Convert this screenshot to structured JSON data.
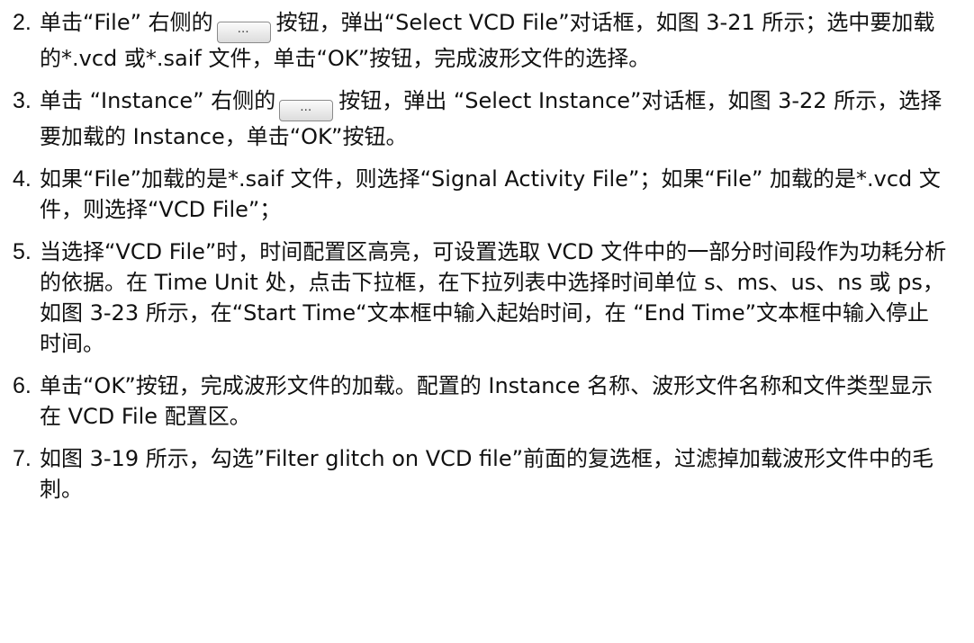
{
  "steps": [
    {
      "num": "2.",
      "parts": [
        {
          "t": "text",
          "v": "单击“File” 右侧的"
        },
        {
          "t": "button",
          "v": "…",
          "name": "ellipsis-button-icon"
        },
        {
          "t": "text",
          "v": "按钮，弹出“Select VCD File”对话框，如图 3-21 所示；选中要加载的*.vcd 或*.saif 文件，单击“OK”按钮，完成波形文件的选择。"
        }
      ]
    },
    {
      "num": "3.",
      "parts": [
        {
          "t": "text",
          "v": "单击 “Instance” 右侧的"
        },
        {
          "t": "button",
          "v": "…",
          "name": "ellipsis-button-icon"
        },
        {
          "t": "text",
          "v": "按钮，弹出 “Select Instance”对话框，如图 3-22 所示，选择要加载的 Instance，单击“OK”按钮。"
        }
      ]
    },
    {
      "num": "4.",
      "parts": [
        {
          "t": "text",
          "v": "如果“File”加载的是*.saif 文件，则选择“Signal Activity File”；如果“File” 加载的是*.vcd 文件，则选择“VCD File”；"
        }
      ]
    },
    {
      "num": "5.",
      "parts": [
        {
          "t": "text",
          "v": "当选择“VCD File”时，时间配置区高亮，可设置选取 VCD 文件中的一部分时间段作为功耗分析的依据。在 Time Unit 处，点击下拉框，在下拉列表中选择时间单位 s、ms、us、ns 或 ps，如图 3-23 所示，在“Start Time“文本框中输入起始时间，在 “End Time”文本框中输入停止时间。"
        }
      ]
    },
    {
      "num": "6.",
      "parts": [
        {
          "t": "text",
          "v": "单击“OK”按钮，完成波形文件的加载。配置的 Instance 名称、波形文件名称和文件类型显示在 VCD File 配置区。"
        }
      ]
    },
    {
      "num": "7.",
      "parts": [
        {
          "t": "text",
          "v": "如图 3-19 所示，勾选”Filter glitch on VCD file”前面的复选框，过滤掉加载波形文件中的毛刺。"
        }
      ]
    }
  ]
}
